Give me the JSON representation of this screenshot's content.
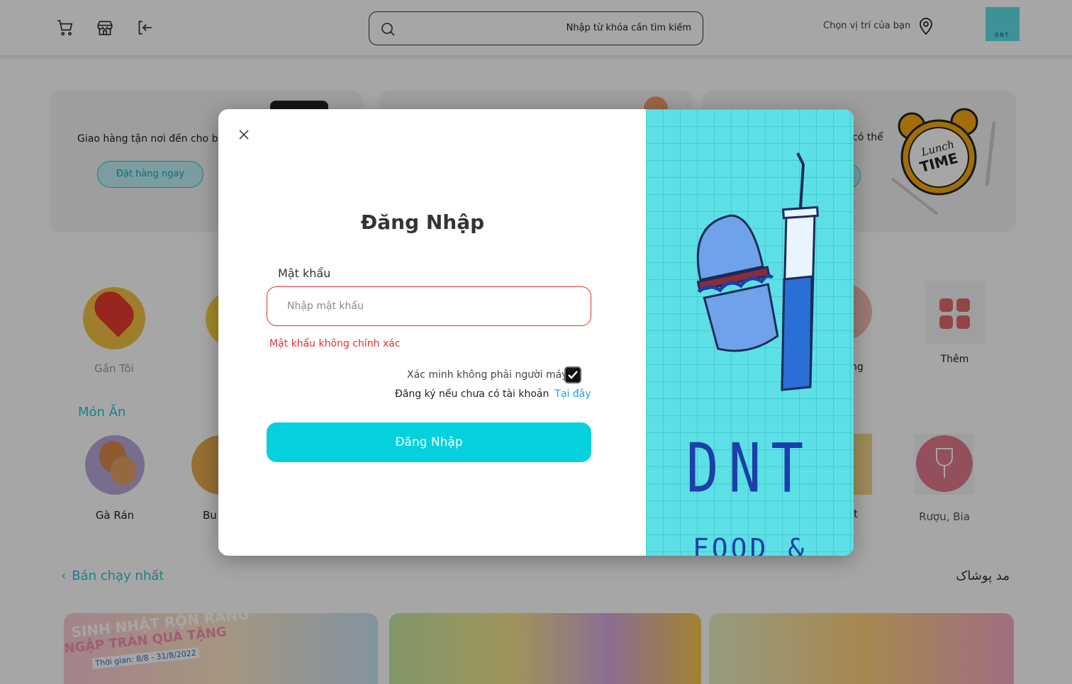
{
  "header": {
    "search_placeholder": "Nhập từ khóa cần tìm kiếm",
    "location_label": "Chọn vị trí của bạn",
    "logo_text": "DNT"
  },
  "promos": [
    {
      "text": "Giao hàng tận nơi đến cho ba",
      "button": "Đặt hàng ngay"
    },
    {
      "text": ""
    },
    {
      "text": "có thể"
    }
  ],
  "categories_row1": [
    {
      "label": "Gần Tôi"
    },
    {
      "label": "ng"
    },
    {
      "label": "Thêm"
    }
  ],
  "food_section_title": "Món Ăn",
  "categories_row2": [
    {
      "label": "Gà Rán"
    },
    {
      "label": "Bu"
    },
    {
      "label": "t"
    },
    {
      "label": "Rượu, Bia"
    }
  ],
  "bestseller_title": "Bán chạy nhất",
  "right_section_title": "مد پوشاک",
  "banner_text": {
    "line1": "SINH NHẬT RỘN RÀNG",
    "line2": "NGẬP TRÀN QUÀ TẶNG",
    "line3": "Thời gian: 8/8 - 31/8/2022"
  },
  "modal": {
    "title": "Đăng Nhập",
    "password_label": "Mật khẩu",
    "password_placeholder": "Nhập mật khẩu",
    "error": "Mật khẩu không chính xác",
    "verify_label": "Xác minh không phải người máy",
    "register_text": "Đăng ký nếu chưa có tài khoản",
    "register_link": "Tại đây",
    "submit_label": "Đăng Nhập",
    "brand": "DNT",
    "brand_sub": "FOOD & DRINK"
  },
  "colors": {
    "accent": "#05d1dd",
    "error": "#e53030",
    "link": "#1a9fe0",
    "brand_bg": "#5ce0e6",
    "brand_text": "#1c3fa8"
  }
}
